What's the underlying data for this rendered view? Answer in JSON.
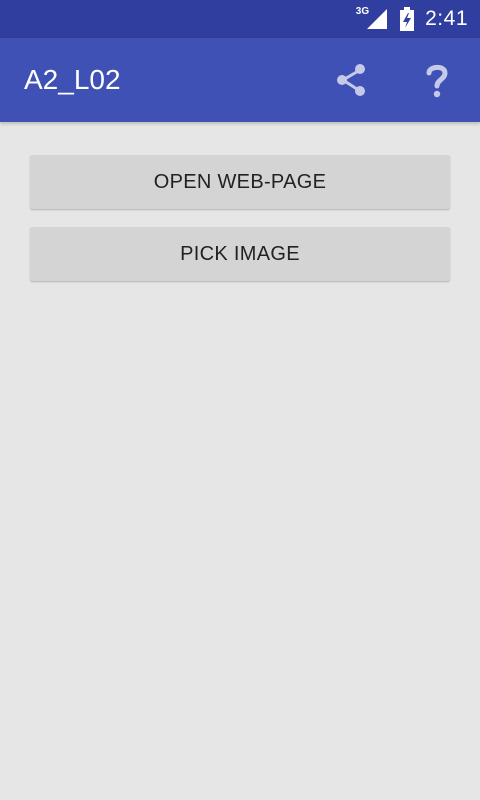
{
  "status_bar": {
    "network_type": "3G",
    "time": "2:41",
    "icons": [
      "signal-icon",
      "battery-charging-icon"
    ]
  },
  "app_bar": {
    "title": "A2_L02",
    "actions": [
      "share-icon",
      "help-icon"
    ]
  },
  "main": {
    "buttons": [
      {
        "label": "OPEN WEB-PAGE"
      },
      {
        "label": "PICK IMAGE"
      }
    ]
  },
  "colors": {
    "status_bar": "#303f9f",
    "app_bar": "#3f51b5",
    "background": "#e6e6e6",
    "button": "#d4d4d4"
  }
}
